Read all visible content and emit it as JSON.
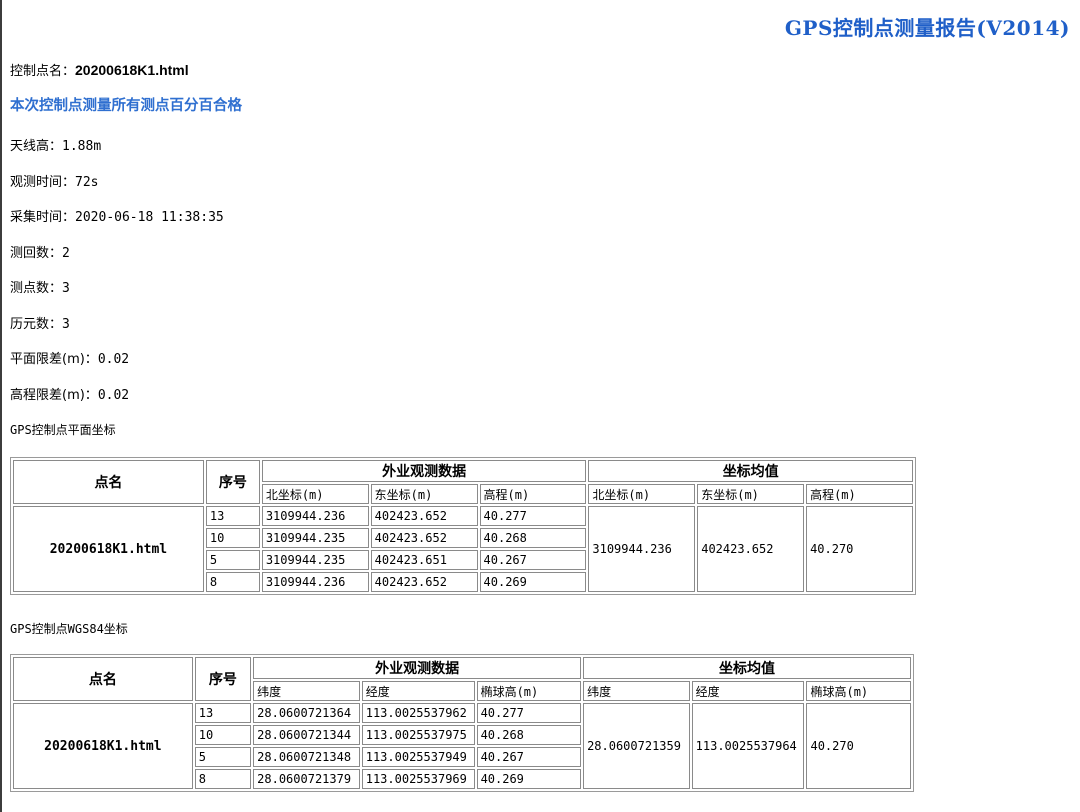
{
  "report": {
    "title": "GPS控制点测量报告(V2014)",
    "point_name_label": "控制点名：",
    "point_name_value": "20200618K1.html",
    "status": "本次控制点测量所有测点百分百合格",
    "info_lines": [
      {
        "label": "天线高：",
        "value": "1.88m"
      },
      {
        "label": "观测时间：",
        "value": "72s"
      },
      {
        "label": "采集时间：",
        "value": "2020-06-18 11:38:35"
      },
      {
        "label": "测回数：",
        "value": "2"
      },
      {
        "label": "测点数：",
        "value": "3"
      },
      {
        "label": "历元数：",
        "value": "3"
      },
      {
        "label": "平面限差(m)：",
        "value": "0.02"
      },
      {
        "label": "高程限差(m)：",
        "value": "0.02"
      }
    ]
  },
  "plane_table": {
    "section_title": "GPS控制点平面坐标",
    "headers": {
      "name": "点名",
      "seq": "序号",
      "field_group": "外业观测数据",
      "mean_group": "坐标均值",
      "cols": [
        "北坐标(m)",
        "东坐标(m)",
        "高程(m)"
      ],
      "mean_cols": [
        "北坐标(m)",
        "东坐标(m)",
        "高程(m)"
      ]
    },
    "point_name": "20200618K1.html",
    "rows": [
      {
        "seq": "13",
        "v1": "3109944.236",
        "v2": "402423.652",
        "v3": "40.277"
      },
      {
        "seq": "10",
        "v1": "3109944.235",
        "v2": "402423.652",
        "v3": "40.268"
      },
      {
        "seq": "5",
        "v1": "3109944.235",
        "v2": "402423.651",
        "v3": "40.267"
      },
      {
        "seq": "8",
        "v1": "3109944.236",
        "v2": "402423.652",
        "v3": "40.269"
      }
    ],
    "mean": {
      "v1": "3109944.236",
      "v2": "402423.652",
      "v3": "40.270"
    }
  },
  "wgs_table": {
    "section_title": "GPS控制点WGS84坐标",
    "headers": {
      "name": "点名",
      "seq": "序号",
      "field_group": "外业观测数据",
      "mean_group": "坐标均值",
      "cols": [
        "纬度",
        "经度",
        "椭球高(m)"
      ],
      "mean_cols": [
        "纬度",
        "经度",
        "椭球高(m)"
      ]
    },
    "point_name": "20200618K1.html",
    "rows": [
      {
        "seq": "13",
        "v1": "28.0600721364",
        "v2": "113.0025537962",
        "v3": "40.277"
      },
      {
        "seq": "10",
        "v1": "28.0600721344",
        "v2": "113.0025537975",
        "v3": "40.268"
      },
      {
        "seq": "5",
        "v1": "28.0600721348",
        "v2": "113.0025537949",
        "v3": "40.267"
      },
      {
        "seq": "8",
        "v1": "28.0600721379",
        "v2": "113.0025537969",
        "v3": "40.269"
      }
    ],
    "mean": {
      "v1": "28.0600721359",
      "v2": "113.0025537964",
      "v3": "40.270"
    }
  },
  "colors": {
    "title": "#1f5fc8",
    "status": "#2f6fd0"
  }
}
